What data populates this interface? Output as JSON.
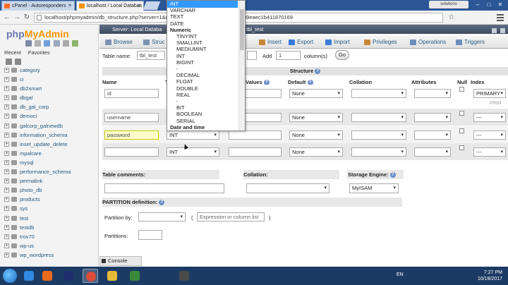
{
  "browser": {
    "tabs": [
      {
        "title": "cPanel - Autoresponders",
        "color": "#ff6c2c"
      },
      {
        "title": "localhost / Local Databas",
        "color": "#f89406"
      }
    ],
    "profile": "solutions",
    "url": "localhost/phpmyadmin/db_structure.php?server=1&d",
    "url_tail": "89eaec1b411870169"
  },
  "sidebar": {
    "logo_php": "php",
    "logo_myadmin": "MyAdmin",
    "tabs": [
      "Recent",
      "Favorites"
    ],
    "databases": [
      "category",
      "ci",
      "db2smart",
      "dbgal",
      "db_gal_corp",
      "democi",
      "galcorp_galnewdb",
      "information_schema",
      "inset_update_delete",
      "mpalcare",
      "mysql",
      "performance_schema",
      "permalink",
      "photo_db",
      "products",
      "sys",
      "test",
      "testdb",
      "trov70",
      "wp-us",
      "wp_wordpress"
    ]
  },
  "main": {
    "breadcrumb_server": "Server: Local Databa",
    "breadcrumb_table": "ble: tbl_test",
    "tabs": [
      {
        "label": "Browse",
        "icon_color": "#7d93b5"
      },
      {
        "label": "Struc",
        "icon_color": "#7d93b5"
      },
      {
        "label": "Insert",
        "icon_color": "#c9863b"
      },
      {
        "label": "Export",
        "icon_color": "#3a7bd5"
      },
      {
        "label": "Import",
        "icon_color": "#3a7bd5"
      },
      {
        "label": "Privileges",
        "icon_color": "#c9863b"
      },
      {
        "label": "Operations",
        "icon_color": "#6d8fbf"
      },
      {
        "label": "Triggers",
        "icon_color": "#6d8fbf"
      }
    ],
    "table_name_label": "Table name:",
    "table_name_value": "tbl_test",
    "add_label": "Add",
    "add_value": "1",
    "columns_label": "column(s)",
    "go_label": "Go",
    "structure_label": "Structure",
    "columns": {
      "name": "Name",
      "t": "T",
      "values": "Values",
      "default": "Default",
      "collation": "Collation",
      "attributes": "Attributes",
      "null": "Null",
      "index": "Index"
    },
    "rows": [
      {
        "name": "id",
        "placeholder": false,
        "type": "",
        "default": "None",
        "index": "PRIMARY",
        "index_extra": "PRIM"
      },
      {
        "name": "username",
        "placeholder": false,
        "type": "",
        "default": "None",
        "index": "---",
        "index_extra": ""
      },
      {
        "name": "password",
        "placeholder": false,
        "type": "INT",
        "default": "None",
        "index": "---",
        "index_extra": ""
      },
      {
        "name": "",
        "placeholder": false,
        "type": "INT",
        "default": "None",
        "index": "---",
        "index_extra": ""
      }
    ],
    "table_comments_label": "Table comments:",
    "collation_label": "Collation:",
    "storage_engine_label": "Storage Engine:",
    "storage_engine_value": "MyISAM",
    "partition_label": "PARTITION definition:",
    "partition_by_label": "Partition by:",
    "partition_paren_open": "(",
    "partition_expr_placeholder": "Expression or column list",
    "partition_paren_close": ")",
    "partitions_label": "Partitions:",
    "console_label": "Console"
  },
  "type_dropdown": {
    "options": [
      {
        "label": "INT",
        "kind": "item",
        "selected": true
      },
      {
        "label": "VARCHAR",
        "kind": "item",
        "selected": false
      },
      {
        "label": "TEXT",
        "kind": "item",
        "selected": false
      },
      {
        "label": "DATE",
        "kind": "item",
        "selected": false
      },
      {
        "label": "Numeric",
        "kind": "group",
        "selected": false
      },
      {
        "label": "TINYINT",
        "kind": "sub",
        "selected": false
      },
      {
        "label": "SMALLINT",
        "kind": "sub",
        "selected": false
      },
      {
        "label": "MEDIUMINT",
        "kind": "sub",
        "selected": false
      },
      {
        "label": "INT",
        "kind": "sub",
        "selected": false
      },
      {
        "label": "BIGINT",
        "kind": "sub",
        "selected": false
      },
      {
        "label": "-",
        "kind": "sub",
        "selected": false
      },
      {
        "label": "DECIMAL",
        "kind": "sub",
        "selected": false
      },
      {
        "label": "FLOAT",
        "kind": "sub",
        "selected": false
      },
      {
        "label": "DOUBLE",
        "kind": "sub",
        "selected": false
      },
      {
        "label": "REAL",
        "kind": "sub",
        "selected": false
      },
      {
        "label": "-",
        "kind": "sub",
        "selected": false
      },
      {
        "label": "BIT",
        "kind": "sub",
        "selected": false
      },
      {
        "label": "BOOLEAN",
        "kind": "sub",
        "selected": false
      },
      {
        "label": "SERIAL",
        "kind": "sub",
        "selected": false
      },
      {
        "label": "Date and time",
        "kind": "group",
        "selected": false
      }
    ]
  },
  "taskbar": {
    "apps": [
      {
        "name": "ie",
        "color": "#2f8ae0"
      },
      {
        "name": "firefox",
        "color": "#e86a1c"
      },
      {
        "name": "photoshop",
        "color": "#1d2f6e"
      },
      {
        "name": "chrome",
        "color": "#dd4b39"
      },
      {
        "name": "explorer",
        "color": "#e7b93a"
      },
      {
        "name": "app-green",
        "color": "#3a8a3a"
      },
      {
        "name": "app-dark",
        "color": "#4a4a4a"
      }
    ],
    "lang": "EN",
    "time": "7:27 PM",
    "date": "10/18/2017"
  }
}
